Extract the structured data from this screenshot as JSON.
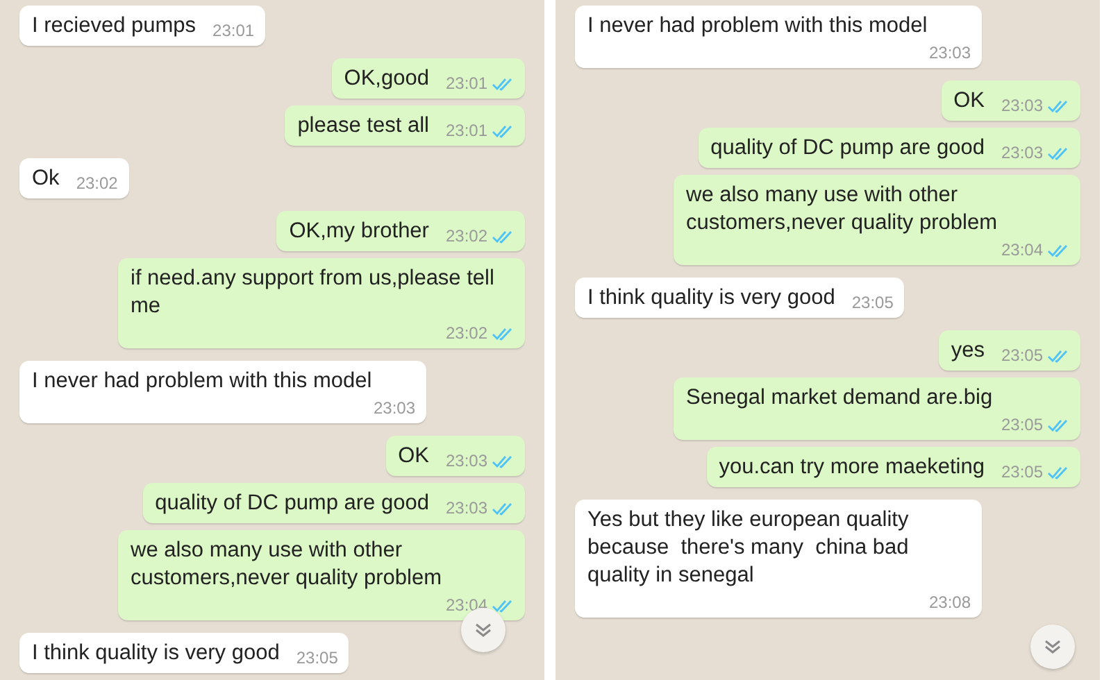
{
  "panels": [
    {
      "messages": [
        {
          "kind": "incoming",
          "text": "I recieved pumps",
          "time": "23:01"
        },
        {
          "kind": "outgoing",
          "text": "OK,good",
          "time": "23:01",
          "read": true
        },
        {
          "kind": "outgoing",
          "text": "please test all",
          "time": "23:01",
          "read": true
        },
        {
          "kind": "incoming",
          "text": "Ok",
          "time": "23:02"
        },
        {
          "kind": "outgoing",
          "text": "OK,my brother",
          "time": "23:02",
          "read": true
        },
        {
          "kind": "outgoing",
          "text": "if need.any support from us,please tell me",
          "time": "23:02",
          "read": true
        },
        {
          "kind": "incoming",
          "text": "I never had problem with this model",
          "time": "23:03"
        },
        {
          "kind": "outgoing",
          "text": "OK",
          "time": "23:03",
          "read": true
        },
        {
          "kind": "outgoing",
          "text": "quality of DC pump are good",
          "time": "23:03",
          "read": true
        },
        {
          "kind": "outgoing",
          "text": "we also many use with other customers,never quality problem",
          "time": "23:04",
          "read": true
        },
        {
          "kind": "incoming",
          "text": "I think quality is very good",
          "time": "23:05"
        }
      ]
    },
    {
      "messages": [
        {
          "kind": "incoming",
          "text": "I never had problem with this model",
          "time": "23:03"
        },
        {
          "kind": "outgoing",
          "text": "OK",
          "time": "23:03",
          "read": true
        },
        {
          "kind": "outgoing",
          "text": "quality of DC pump are good",
          "time": "23:03",
          "read": true
        },
        {
          "kind": "outgoing",
          "text": "we also many use with other customers,never quality problem",
          "time": "23:04",
          "read": true
        },
        {
          "kind": "incoming",
          "text": "I think quality is very good",
          "time": "23:05"
        },
        {
          "kind": "outgoing",
          "text": "yes",
          "time": "23:05",
          "read": true
        },
        {
          "kind": "outgoing",
          "text": "Senegal market demand are.big",
          "time": "23:05",
          "read": true
        },
        {
          "kind": "outgoing",
          "text": "you.can try more maeketing",
          "time": "23:05",
          "read": true
        },
        {
          "kind": "incoming",
          "text": "Yes but they like european quality because  there's many  china bad quality in senegal",
          "time": "23:08"
        }
      ]
    }
  ]
}
